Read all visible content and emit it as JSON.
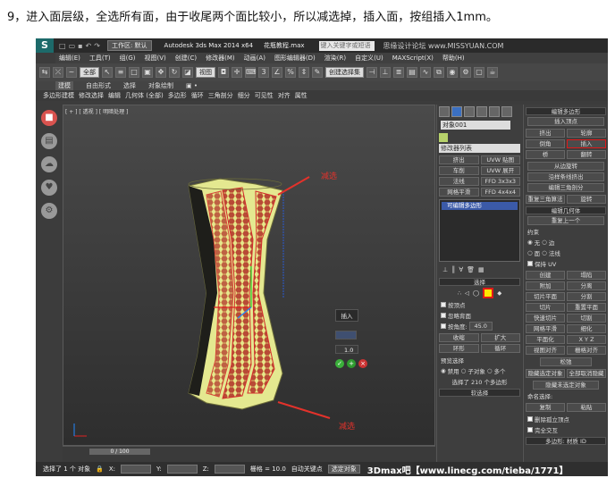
{
  "caption": "9，进入面层级，全选所有面，由于收尾两个面比较小，所以减选掉，插入面，按组插入1mm。",
  "titlebar": {
    "workspace": "工作区: 默认",
    "app_title": "Autodesk 3ds Max  2014 x64",
    "file_title": "花瓶教程.max",
    "search_placeholder": "键入关键字或短语",
    "watermark": "思缘设计论坛  www.MISSYUAN.COM"
  },
  "menubar": [
    "编辑(E)",
    "工具(T)",
    "组(G)",
    "视图(V)",
    "创建(C)",
    "修改器(M)",
    "动画(A)",
    "图形编辑器(D)",
    "渲染(R)",
    "自定义(U)",
    "MAXScript(X)",
    "帮助(H)"
  ],
  "toolbar": {
    "filter": "全部",
    "view": "视图",
    "selection_set": "创建选择集"
  },
  "ribbon": {
    "tabs": [
      "建模",
      "自由形式",
      "选择",
      "对象绘制"
    ]
  },
  "ribbon2": {
    "items": [
      "多边形建模",
      "修改选择",
      "编辑",
      "几何体 (全部)",
      "多边形",
      "循环",
      "三角剖分",
      "细分",
      "可见性",
      "对齐",
      "属性"
    ]
  },
  "viewport": {
    "label": "[ + ] [ 透视 ] [ 明暗处理 ]"
  },
  "annotations": {
    "top": "减选",
    "bottom": "减选"
  },
  "inset_popup": {
    "title": "插入",
    "value": "1.0"
  },
  "timebar": {
    "frame": "0 / 100"
  },
  "statusbar": {
    "selected": "选择了 1 个 对象",
    "x_label": "X:",
    "y_label": "Y:",
    "z_label": "Z:",
    "grid": "栅格 = 10.0",
    "autokey": "自动关键点",
    "selected_obj": "选定对象"
  },
  "command_panel": {
    "object_name": "对象001",
    "modifier_list": "修改器列表",
    "buttons": [
      "挤出",
      "UVW 贴图",
      "车削",
      "UVW 展开",
      "法线",
      "FFD 3x3x3",
      "网格平滑",
      "FFD 4x4x4"
    ],
    "stack_item": "可编辑多边形",
    "selection": {
      "header": "选择",
      "by_vertex": "按顶点",
      "ignore_backfacing": "忽略背面",
      "by_angle": "按角度:",
      "angle_value": "45.0",
      "shrink": "收缩",
      "grow": "扩大",
      "ring": "环形",
      "loop": "循环",
      "preview_label": "预览选择",
      "preview_options": [
        "禁用",
        "子对象",
        "多个"
      ],
      "status": "选择了 210 个多边形"
    },
    "soft_selection": "软选择"
  },
  "right_panel": {
    "edit_poly_header": "编辑多边形",
    "insert_vertex": "插入顶点",
    "buttons": [
      "挤出",
      "轮廓",
      "倒角",
      "插入",
      "桥",
      "翻转"
    ],
    "hinge": "从边旋转",
    "extrude_spline": "沿样条线挤出",
    "edit_tri": "编辑三角剖分",
    "retriangulate": "重复三角算法",
    "turn": "旋转",
    "edit_geom_header": "编辑几何体",
    "repeat_last": "重复上一个",
    "constraints_label": "约束",
    "constraints": [
      "无",
      "边",
      "面",
      "法线"
    ],
    "preserve_uv": "保持 UV",
    "geom_buttons": [
      "创建",
      "塌陷",
      "附加",
      "分离",
      "切片平面",
      "分割",
      "切片",
      "重置平面",
      "快速切片",
      "切割"
    ],
    "meshsmooth": "网格平滑",
    "tessellate": "细化",
    "planarize": "平面化",
    "xyz": [
      "X",
      "Y",
      "Z"
    ],
    "view_align": "视图对齐",
    "grid_align": "栅格对齐",
    "relax": "松弛",
    "hide_sel": "隐藏选定对象",
    "unhide_all": "全部取消隐藏",
    "hide_unsel": "隐藏未选定对象",
    "named_sel": "命名选择:",
    "copy": "复制",
    "paste": "粘贴",
    "delete_iso": "删除孤立顶点",
    "full_interact": "完全交互",
    "material_header": "多边形: 材质 ID"
  },
  "watermark_bottom": "3Dmax吧【www.linecg.com/tieba/1771】"
}
